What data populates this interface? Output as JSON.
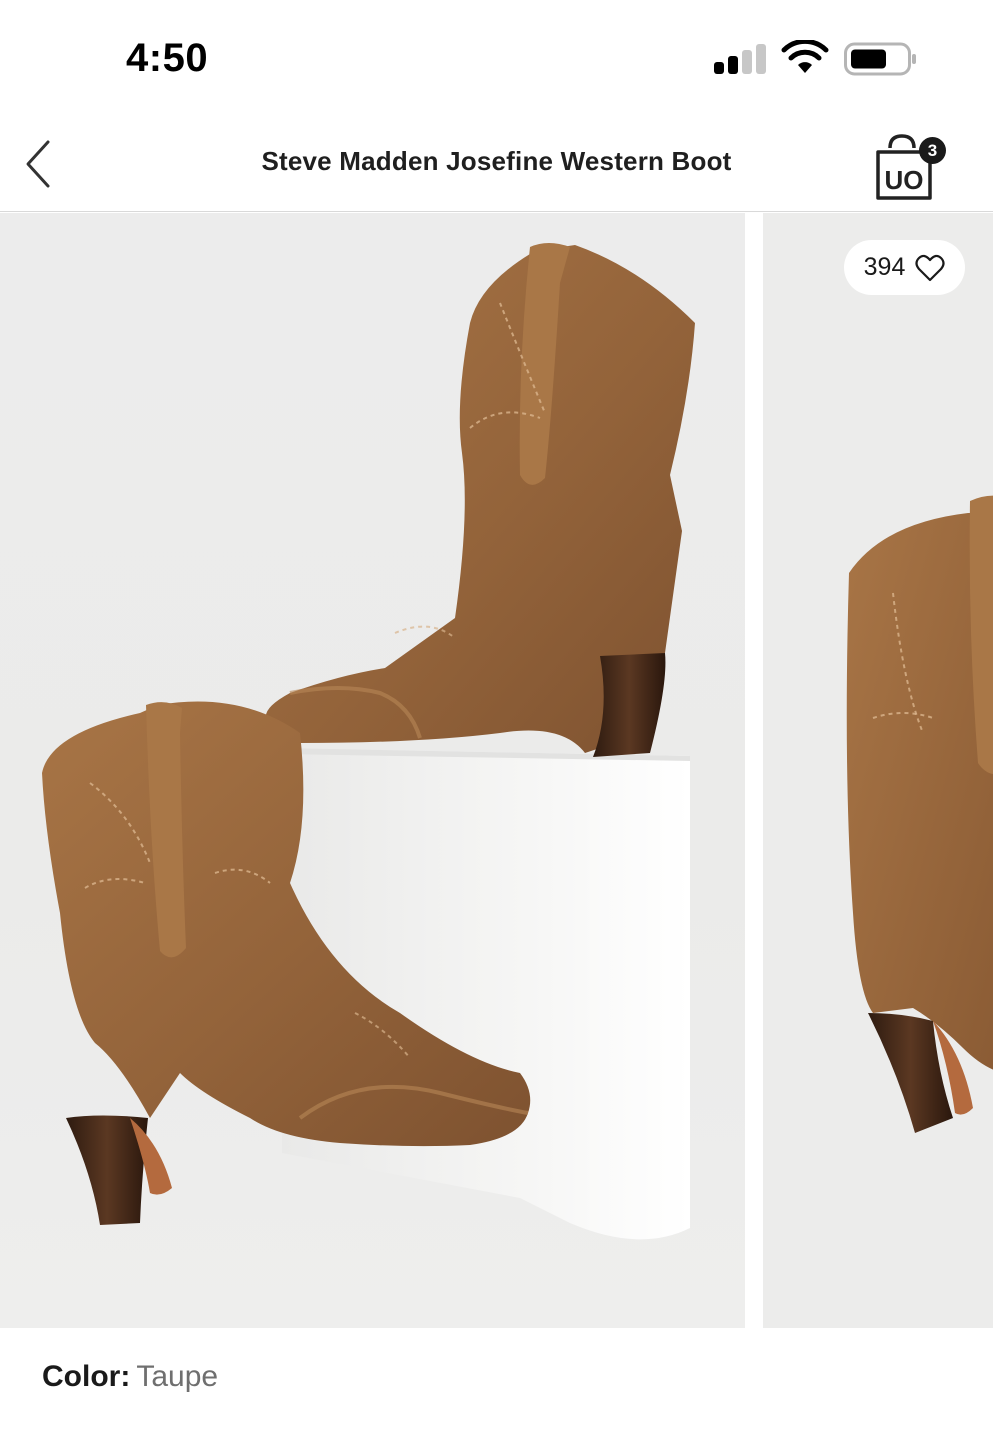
{
  "status_bar": {
    "time": "4:50",
    "signal_icon": "cellular-signal-icon",
    "wifi_icon": "wifi-icon",
    "battery_icon": "battery-icon"
  },
  "nav": {
    "back_icon": "chevron-left-icon",
    "title": "Steve Madden Josefine Western Boot",
    "cart_icon": "shopping-bag-icon",
    "cart_logo": "UO",
    "cart_count": "3"
  },
  "gallery": {
    "favorite_count": "394",
    "favorite_icon": "heart-icon",
    "colors": {
      "suede": "#9a6a3e",
      "heel": "#3b2417",
      "block": "#f4f4f3",
      "background": "#ececec"
    }
  },
  "product": {
    "color_label": "Color:",
    "color_value": "Taupe"
  }
}
